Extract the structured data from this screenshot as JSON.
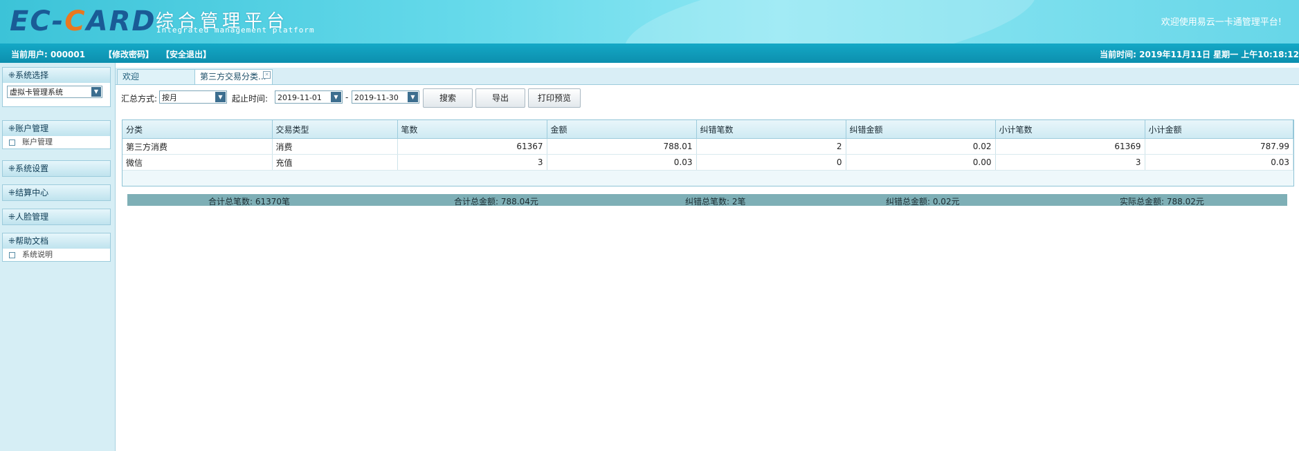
{
  "header": {
    "logo_part1": "EC-",
    "logo_c": "C",
    "logo_part2": "ARD",
    "title": "综合管理平台",
    "subtitle": "Integrated management platform",
    "welcome": "欢迎使用易云一卡通管理平台!"
  },
  "userbar": {
    "current_user": "当前用户:  000001",
    "change_password": "【修改密码】",
    "logout": "【安全退出】",
    "current_time": "当前时间:  2019年11月11日 星期一 上午10:18:12"
  },
  "sidebar": {
    "system_select": {
      "title": "系统选择",
      "value": "虚拟卡管理系统"
    },
    "account": {
      "title": "账户管理",
      "items": [
        "账户管理"
      ]
    },
    "settings": {
      "title": "系统设置"
    },
    "settlement": {
      "title": "结算中心"
    },
    "face": {
      "title": "人脸管理"
    },
    "help": {
      "title": "帮助文档",
      "items": [
        "系统说明"
      ]
    }
  },
  "tabs": [
    {
      "label": "欢迎"
    },
    {
      "label": "第三方交易分类..."
    }
  ],
  "toolbar": {
    "summary_label": "汇总方式:",
    "summary_value": "按月",
    "date_label": "起止时间:",
    "date_from": "2019-11-01",
    "date_sep": "-",
    "date_to": "2019-11-30",
    "search": "搜索",
    "export": "导出",
    "print_preview": "打印预览"
  },
  "table": {
    "columns": [
      "分类",
      "交易类型",
      "笔数",
      "金额",
      "纠错笔数",
      "纠错金额",
      "小计笔数",
      "小计金额"
    ],
    "rows": [
      [
        "第三方消费",
        "消费",
        "61367",
        "788.01",
        "2",
        "0.02",
        "61369",
        "787.99"
      ],
      [
        "微信",
        "充值",
        "3",
        "0.03",
        "0",
        "0.00",
        "3",
        "0.03"
      ]
    ]
  },
  "summary": {
    "total_count": "合计总笔数: 61370笔",
    "total_amount": "合计总金额: 788.04元",
    "correction_count": "纠错总笔数: 2笔",
    "correction_amount": "纠错总金额: 0.02元",
    "actual_amount": "实际总金额: 788.02元"
  }
}
